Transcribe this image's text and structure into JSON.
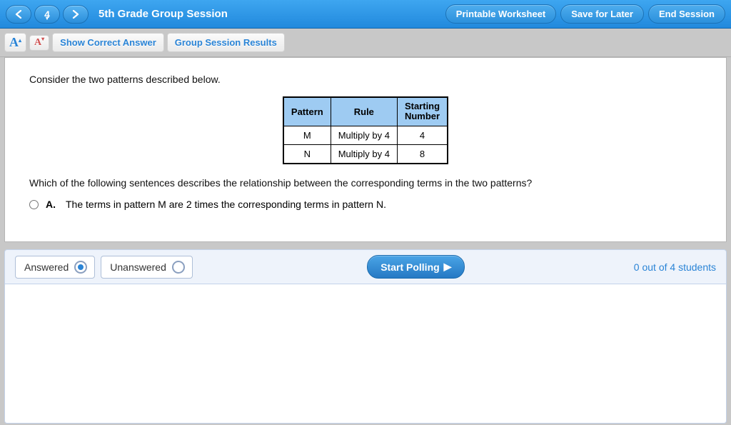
{
  "header": {
    "question_number": "4",
    "title": "5th Grade Group Session",
    "buttons": {
      "printable": "Printable Worksheet",
      "save": "Save for Later",
      "end": "End Session"
    }
  },
  "toolbar": {
    "font_up": "A",
    "font_down": "A",
    "show_answer": "Show Correct Answer",
    "results": "Group Session Results"
  },
  "question": {
    "intro": "Consider the two patterns described below.",
    "table": {
      "headers": {
        "c1": "Pattern",
        "c2": "Rule",
        "c3": "Starting Number"
      },
      "rows": [
        {
          "pattern": "M",
          "rule": "Multiply by 4",
          "start": "4"
        },
        {
          "pattern": "N",
          "rule": "Multiply by 4",
          "start": "8"
        }
      ]
    },
    "prompt": "Which of the following sentences describes the relationship between the corresponding terms in the two patterns?",
    "choices": [
      {
        "letter": "A.",
        "text": "The terms in pattern M are 2 times the corresponding terms in pattern N."
      }
    ]
  },
  "footer": {
    "filters": {
      "answered": "Answered",
      "unanswered": "Unanswered"
    },
    "start_polling": "Start Polling",
    "status": "0 out of 4 students"
  }
}
